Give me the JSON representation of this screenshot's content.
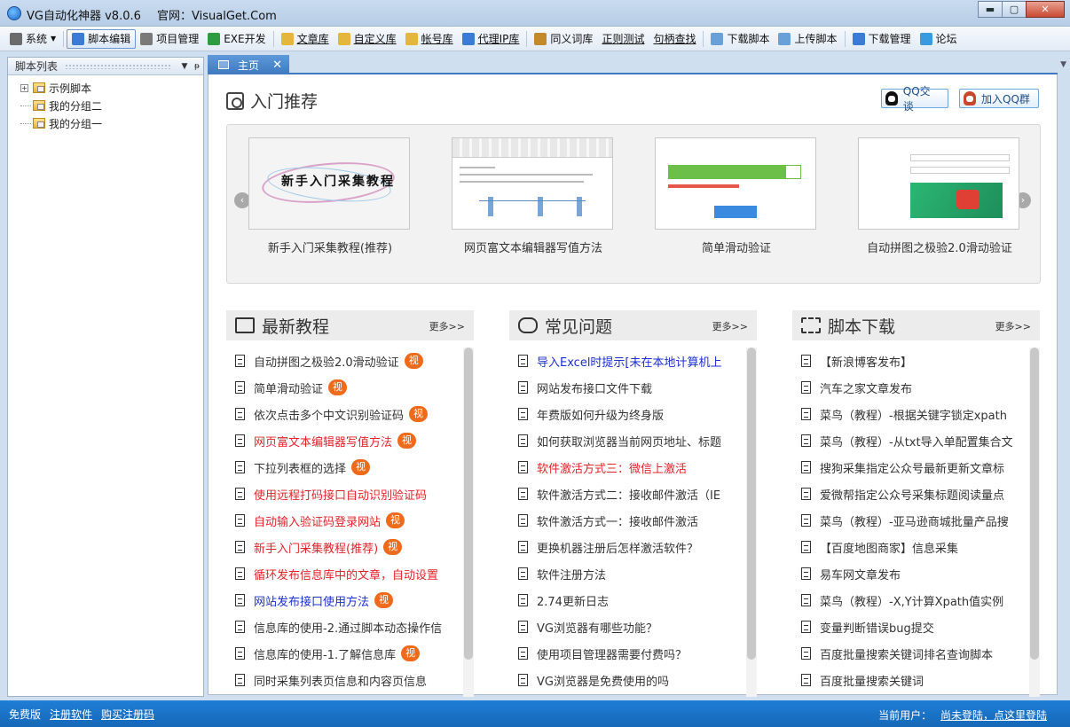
{
  "window": {
    "app_title": "VG自动化神器 v8.0.6",
    "site_label": "官网：VisualGet.Com",
    "min": "▬",
    "max": "▢",
    "close": "✕"
  },
  "toolbar": {
    "items": [
      {
        "label": "系统",
        "icon": "gear-icon",
        "color": "#6b6b6b"
      },
      {
        "label": "脚本编辑",
        "icon": "script-edit-icon",
        "color": "#3a7bd5"
      },
      {
        "label": "项目管理",
        "icon": "project-icon",
        "color": "#7a7a7a"
      },
      {
        "label": "EXE开发",
        "icon": "exe-icon",
        "color": "#2e9b3f"
      },
      {
        "label": "文章库",
        "icon": "folder-icon",
        "color": "#e5b63c"
      },
      {
        "label": "自定义库",
        "icon": "folder-icon",
        "color": "#e5b63c"
      },
      {
        "label": "帐号库",
        "icon": "folder-icon",
        "color": "#e5b63c"
      },
      {
        "label": "代理IP库",
        "icon": "globe-icon",
        "color": "#3a7bd5"
      },
      {
        "label": "同义词库",
        "icon": "book-icon",
        "color": "#c28a2a"
      },
      {
        "label": "正则测试",
        "icon": "",
        "color": ""
      },
      {
        "label": "句柄查找",
        "icon": "",
        "color": ""
      },
      {
        "label": "下载脚本",
        "icon": "cloud-download-icon",
        "color": "#6aa0d8"
      },
      {
        "label": "上传脚本",
        "icon": "cloud-upload-icon",
        "color": "#6aa0d8"
      },
      {
        "label": "下载管理",
        "icon": "download-icon",
        "color": "#3a7bd5"
      },
      {
        "label": "论坛",
        "icon": "chat-bubble-icon",
        "color": "#3a9ae0"
      }
    ]
  },
  "left_panel": {
    "title": "脚本列表",
    "pin": "ᵽ",
    "dropdown": "▼",
    "tree": [
      {
        "label": "示例脚本",
        "expand": "+"
      },
      {
        "label": "我的分组二",
        "expand": ""
      },
      {
        "label": "我的分组一",
        "expand": ""
      }
    ]
  },
  "tab": {
    "label": "主页",
    "close": "✕",
    "menu": "▼"
  },
  "intro": {
    "title": "入门推荐",
    "qq_chat": "QQ交谈",
    "qq_group": "加入QQ群",
    "prev": "‹",
    "next": "›",
    "cards": [
      {
        "title": "新手入门采集教程(推荐)",
        "thumb_text": "新手入门采集教程"
      },
      {
        "title": "网页富文本编辑器写值方法"
      },
      {
        "title": "简单滑动验证"
      },
      {
        "title": "自动拼图之极验2.0滑动验证"
      }
    ]
  },
  "columns": {
    "more": "更多>>",
    "tutorials": {
      "title": "最新教程",
      "items": [
        {
          "text": "自动拼图之极验2.0滑动验证",
          "color": "",
          "video": "视"
        },
        {
          "text": "简单滑动验证",
          "color": "",
          "video": "视"
        },
        {
          "text": "依次点击多个中文识别验证码",
          "color": "",
          "video": "视"
        },
        {
          "text": "网页富文本编辑器写值方法",
          "color": "red",
          "video": "视"
        },
        {
          "text": "下拉列表框的选择",
          "color": "",
          "video": "视"
        },
        {
          "text": "使用远程打码接口自动识别验证码",
          "color": "red",
          "video": ""
        },
        {
          "text": "自动输入验证码登录网站",
          "color": "red",
          "video": "视"
        },
        {
          "text": "新手入门采集教程(推荐)",
          "color": "red",
          "video": "视"
        },
        {
          "text": "循环发布信息库中的文章，自动设置",
          "color": "red",
          "video": ""
        },
        {
          "text": "网站发布接口使用方法",
          "color": "blue",
          "video": "视"
        },
        {
          "text": "信息库的使用-2.通过脚本动态操作信",
          "color": "",
          "video": ""
        },
        {
          "text": "信息库的使用-1.了解信息库",
          "color": "",
          "video": "视"
        },
        {
          "text": "同时采集列表页信息和内容页信息",
          "color": "",
          "video": ""
        }
      ]
    },
    "faq": {
      "title": "常见问题",
      "items": [
        {
          "text": "导入Excel时提示[未在本地计算机上",
          "color": "blue"
        },
        {
          "text": "网站发布接口文件下载",
          "color": ""
        },
        {
          "text": "年费版如何升级为终身版",
          "color": ""
        },
        {
          "text": "如何获取浏览器当前网页地址、标题",
          "color": ""
        },
        {
          "text": "软件激活方式三：微信上激活",
          "color": "red"
        },
        {
          "text": "软件激活方式二：接收邮件激活（IE",
          "color": ""
        },
        {
          "text": "软件激活方式一：接收邮件激活",
          "color": ""
        },
        {
          "text": "更换机器注册后怎样激活软件？",
          "color": ""
        },
        {
          "text": "软件注册方法",
          "color": ""
        },
        {
          "text": "2.74更新日志",
          "color": ""
        },
        {
          "text": "VG浏览器有哪些功能？",
          "color": ""
        },
        {
          "text": "使用项目管理器需要付费吗？",
          "color": ""
        },
        {
          "text": "VG浏览器是免费使用的吗",
          "color": ""
        }
      ]
    },
    "downloads": {
      "title": "脚本下载",
      "items": [
        {
          "text": "【新浪博客发布】",
          "color": ""
        },
        {
          "text": "汽车之家文章发布",
          "color": ""
        },
        {
          "text": "菜鸟（教程）-根据关键字锁定xpath",
          "color": ""
        },
        {
          "text": "菜鸟（教程）-从txt导入单配置集合文",
          "color": ""
        },
        {
          "text": "搜狗采集指定公众号最新更新文章标",
          "color": ""
        },
        {
          "text": "爱微帮指定公众号采集标题阅读量点",
          "color": ""
        },
        {
          "text": "菜鸟（教程）-亚马逊商城批量产品搜",
          "color": ""
        },
        {
          "text": "【百度地图商家】信息采集",
          "color": ""
        },
        {
          "text": "易车网文章发布",
          "color": ""
        },
        {
          "text": "菜鸟（教程）-X,Y计算Xpath值实例",
          "color": ""
        },
        {
          "text": "变量判断错误bug提交",
          "color": ""
        },
        {
          "text": "百度批量搜索关键词排名查询脚本",
          "color": ""
        },
        {
          "text": "百度批量搜索关键词",
          "color": ""
        }
      ]
    }
  },
  "statusbar": {
    "edition": "免费版",
    "register": "注册软件",
    "buy": "购买注册码",
    "user_label": "当前用户：",
    "login_link": "尚未登陆，点这里登陆"
  },
  "colors": {
    "accent": "#3f79c0",
    "status_bg": "#1f7ed6",
    "video_badge": "#ef6a1b",
    "red_text": "#e2242a",
    "blue_text": "#1c2fd0"
  }
}
